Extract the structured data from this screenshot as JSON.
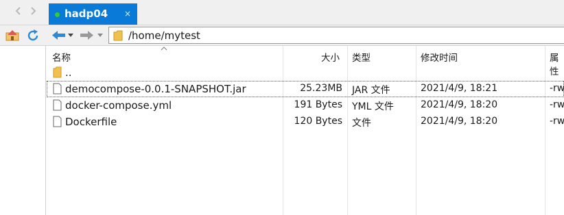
{
  "tab": {
    "title": "hadp04",
    "close_glyph": "×",
    "status_color": "#37c83b",
    "accent": "#0a7ad8"
  },
  "toolbar": {
    "path": "/home/mytest"
  },
  "columns": {
    "name": "名称",
    "size": "大小",
    "type": "类型",
    "modified": "修改时间",
    "attr": "属性"
  },
  "files": [
    {
      "name": "..",
      "size": "",
      "type": "",
      "modified": "",
      "perm": "",
      "icon": "folder-icon"
    },
    {
      "name": "democompose-0.0.1-SNAPSHOT.jar",
      "size": "25.23MB",
      "type": "JAR 文件",
      "modified": "2021/4/9, 18:21",
      "perm": "-rw",
      "icon": "file-icon",
      "selected": true
    },
    {
      "name": "docker-compose.yml",
      "size": "191 Bytes",
      "type": "YML 文件",
      "modified": "2021/4/9, 18:20",
      "perm": "-rw",
      "icon": "file-icon"
    },
    {
      "name": "Dockerfile",
      "size": "120 Bytes",
      "type": "文件",
      "modified": "2021/4/9, 18:20",
      "perm": "-rw",
      "icon": "file-icon"
    }
  ]
}
